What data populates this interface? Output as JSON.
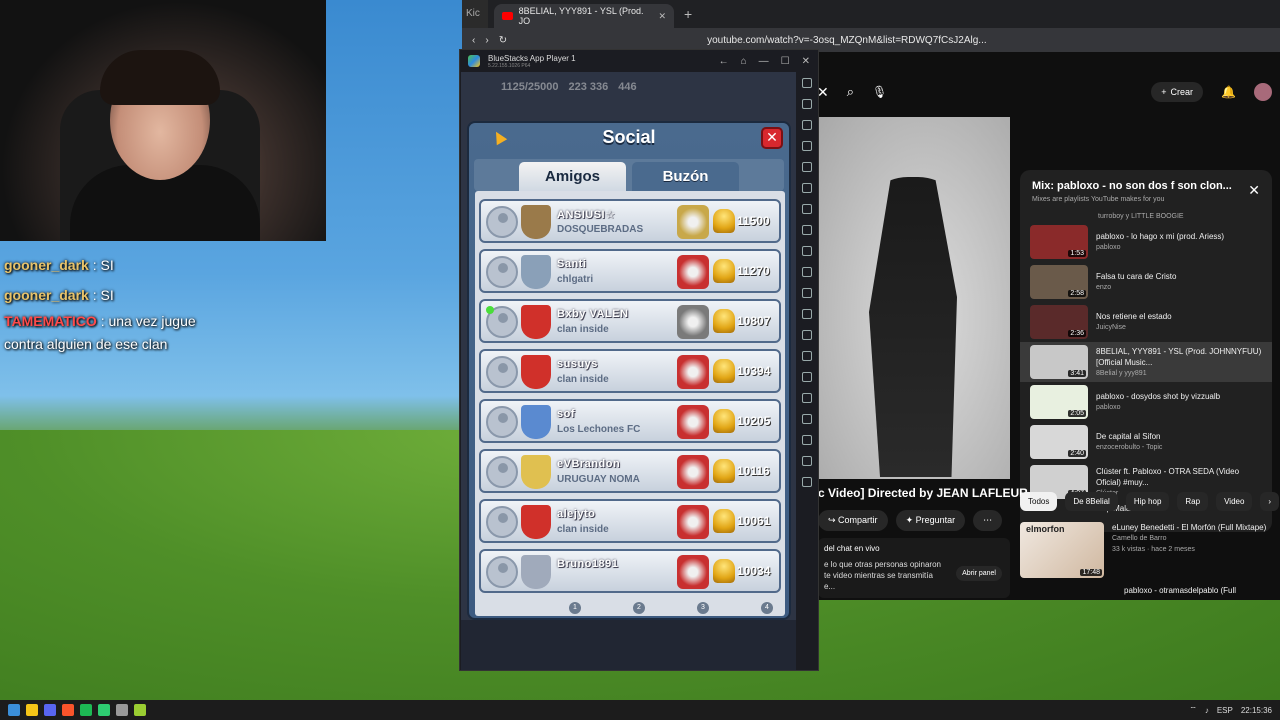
{
  "chat": [
    {
      "user": "gooner_dark",
      "sep": " : ",
      "msg": "SI"
    },
    {
      "user": "gooner_dark",
      "sep": " : ",
      "msg": "SI"
    },
    {
      "user": "TAMEMATICO",
      "sep": " : ",
      "msg": "una vez jugue"
    },
    {
      "user": "",
      "sep": "",
      "msg": "contra alguien de ese clan"
    }
  ],
  "browser": {
    "left_tab_fragment": "Kic",
    "tab_title": "8BELIAL, YYY891 - YSL (Prod. JO",
    "new_tab": "+",
    "url": "youtube.com/watch?v=-3osq_MZQnM&list=RDWQ7fCsJ2Alg..."
  },
  "youtube": {
    "crear": "Crear",
    "video_title": "c Video] Directed by JEAN LAFLEUR",
    "share": "Compartir",
    "ask": "Preguntar",
    "chat_title": "del chat en vivo",
    "chat_text": "e lo que otras personas opinaron te video mientras se transmitía e...",
    "open_panel": "Abrir panel",
    "mix_title": "Mix: pabloxo - no son dos f son clon...",
    "mix_sub": "Mixes are playlists YouTube makes for you",
    "playlist_top": "turroboy y LITTLE BOOGIE",
    "playlist": [
      {
        "title": "pabloxo - lo hago x mi (prod. Ariess)",
        "channel": "pabloxo",
        "duration": "1:53",
        "color": "#8a2a2a"
      },
      {
        "title": "Falsa tu cara de Cristo",
        "channel": "enzo",
        "duration": "2:58",
        "color": "#6a5a4a"
      },
      {
        "title": "Nos retiene el estado",
        "channel": "JuicyNise",
        "duration": "2:36",
        "color": "#5a2a2a"
      },
      {
        "title": "8BELIAL, YYY891 - YSL (Prod. JOHNNYFUU) [Official Music...",
        "channel": "8Belial y yyy891",
        "duration": "3:41",
        "color": "#c8c8c8"
      },
      {
        "title": "pabloxo - dosydos shot by vizzualb",
        "channel": "pabloxo",
        "duration": "2:05",
        "color": "#e8f0e0"
      },
      {
        "title": "De capital al Sifon",
        "channel": "enzocerobulto - Topic",
        "duration": "2:40",
        "color": "#d8d8d8"
      },
      {
        "title": "Clúster ft. Pabloxo - OTRA SEDA (Video Oficial) #muy...",
        "channel": "Clúster",
        "duration": "4:07",
        "color": "#d0d0d0"
      }
    ],
    "playlist_more": "Top Mala",
    "chips": [
      "Todos",
      "De 8Belial",
      "Hip hop",
      "Rap",
      "Video"
    ],
    "rec": {
      "title": "eLuney Benedetti - El Morfón (Full Mixtape)",
      "channel": "Camello de Barro",
      "meta": "33 k vistas · hace 2 meses",
      "duration": "17:48",
      "thumb_text": "elmorfon"
    },
    "rec2": "pabloxo - otramasdelpablo (Full"
  },
  "bluestacks": {
    "title": "BlueStacks App Player 1",
    "version": "5.22.155.1026 P64"
  },
  "game": {
    "top_a": "1125/25000",
    "top_b": "223 336",
    "top_c": "446",
    "panel_title": "Social",
    "tab_friends": "Amigos",
    "tab_inbox": "Buzón",
    "friends": [
      {
        "name": "ANSIUSI☆",
        "clan": "DOSQUEBRADAS",
        "trophies": "11500",
        "badge": "#9a7a4a",
        "arena": "#c8a84a",
        "online": false
      },
      {
        "name": "Santi",
        "clan": "chlgatri",
        "trophies": "11270",
        "badge": "#8aa0b8",
        "arena": "#c83030",
        "online": false
      },
      {
        "name": "Bxby VALEN",
        "clan": "clan inside",
        "trophies": "10807",
        "badge": "#d0302a",
        "arena": "#7a7a7a",
        "online": true
      },
      {
        "name": "susuys",
        "clan": "clan inside",
        "trophies": "10394",
        "badge": "#d0302a",
        "arena": "#c83030",
        "online": false
      },
      {
        "name": "sof",
        "clan": "Los Lechones FC",
        "trophies": "10205",
        "badge": "#5a8ad0",
        "arena": "#c83030",
        "online": false
      },
      {
        "name": "eVBrandon",
        "clan": "URUGUAY NOMA",
        "trophies": "10116",
        "badge": "#e0c050",
        "arena": "#c83030",
        "online": false
      },
      {
        "name": "alejyto",
        "clan": "clan inside",
        "trophies": "10061",
        "badge": "#d0302a",
        "arena": "#c83030",
        "online": false
      },
      {
        "name": "Bruno1891",
        "clan": "",
        "trophies": "10034",
        "badge": "#a0aabb",
        "arena": "#c83030",
        "online": false
      }
    ],
    "pages": [
      "1",
      "2",
      "3",
      "4"
    ]
  },
  "taskbar": {
    "lang": "ESP",
    "time": "22:15:36"
  }
}
